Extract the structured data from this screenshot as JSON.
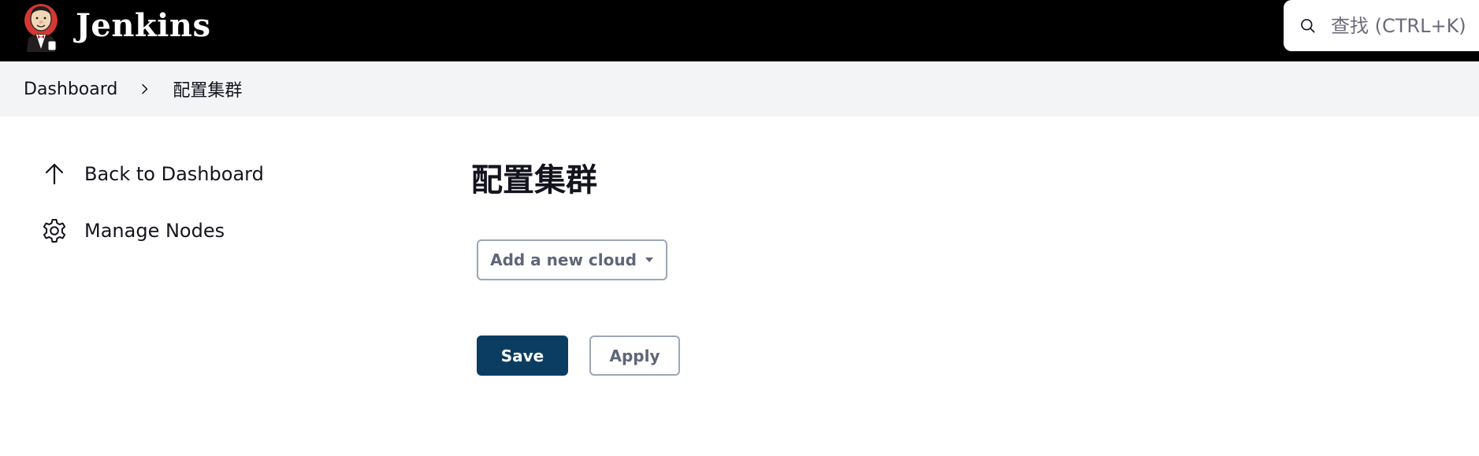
{
  "header": {
    "brand_name": "Jenkins",
    "logo_icon": "jenkins-butler-logo",
    "search": {
      "icon": "search-icon",
      "placeholder": "查找 (CTRL+K)"
    }
  },
  "breadcrumb": {
    "items": [
      {
        "label": "Dashboard"
      },
      {
        "label": "配置集群"
      }
    ],
    "separator_icon": "chevron-right-icon"
  },
  "side_panel": {
    "items": [
      {
        "label": "Back to Dashboard",
        "icon": "arrow-up-icon"
      },
      {
        "label": "Manage Nodes",
        "icon": "gear-icon"
      }
    ]
  },
  "main": {
    "title": "配置集群",
    "add_cloud_label": "Add a new cloud",
    "save_label": "Save",
    "apply_label": "Apply"
  },
  "colors": {
    "header_bg": "#000000",
    "breadcrumb_bg": "#f3f4f6",
    "primary_button": "#0b3d62",
    "secondary_border": "#9ba7b4"
  }
}
